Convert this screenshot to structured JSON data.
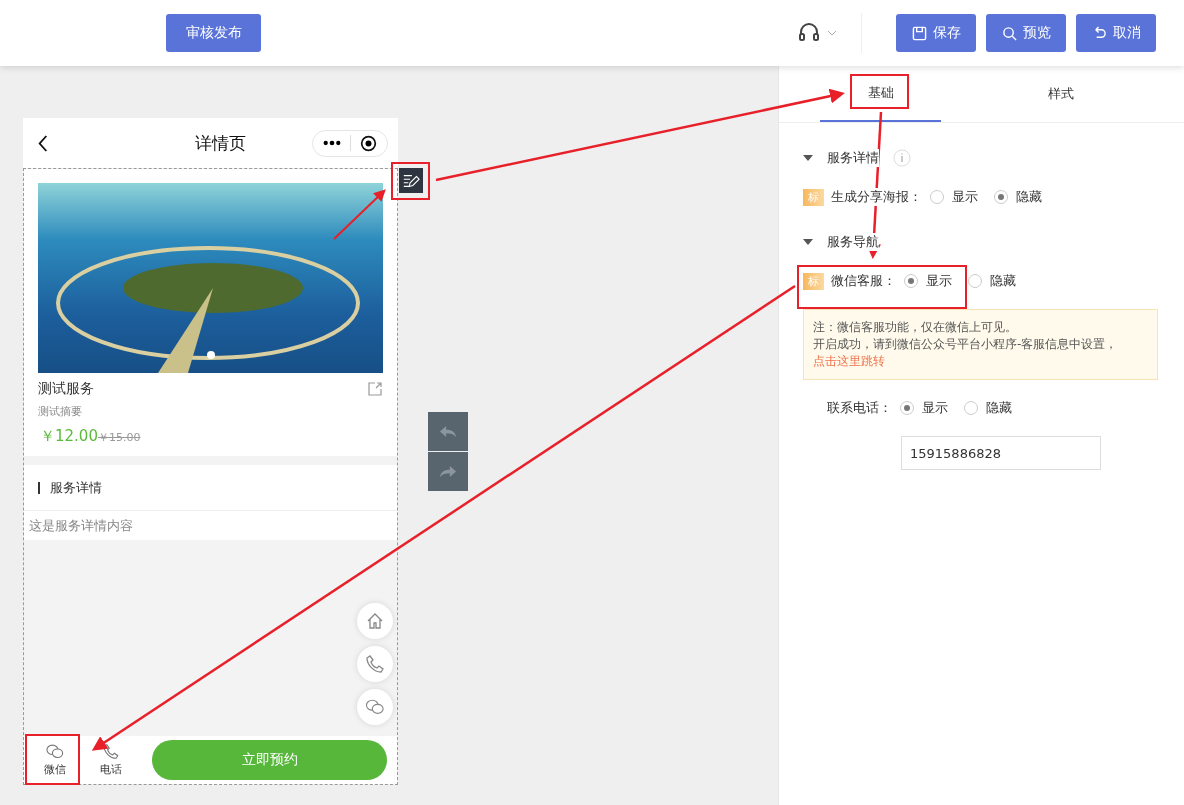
{
  "toolbar": {
    "publish_button": "审核发布",
    "buttons": [
      {
        "label": "保存",
        "kind": "save"
      },
      {
        "label": "预览",
        "kind": "preview"
      },
      {
        "label": "取消",
        "kind": "cancel"
      }
    ]
  },
  "phone": {
    "title": "详情页",
    "service_name": "测试服务",
    "summary": "测试摘要",
    "price": "￥12.00",
    "original_price": "￥15.00",
    "section_title": "服务详情",
    "section_content": "这是服务详情内容",
    "bottom_items": [
      {
        "label": "微信",
        "kind": "wechat"
      },
      {
        "label": "电话",
        "kind": "phone"
      }
    ],
    "book_button": "立即预约"
  },
  "tabs": [
    {
      "label": "基础",
      "selected": true
    },
    {
      "label": "样式",
      "selected": false
    }
  ],
  "sections": [
    {
      "title": "服务详情",
      "info": true,
      "rows": [
        {
          "kind": "radio",
          "badge": "标",
          "label": "生成分享海报：",
          "options": [
            {
              "label": "显示",
              "selected": false
            },
            {
              "label": "隐藏",
              "selected": true
            }
          ]
        }
      ]
    },
    {
      "title": "服务导航",
      "info": false,
      "rows": [
        {
          "kind": "radio",
          "badge": "标",
          "label": "微信客服：",
          "options": [
            {
              "label": "显示",
              "selected": true
            },
            {
              "label": "隐藏",
              "selected": false
            }
          ]
        },
        {
          "kind": "notice",
          "lines": [
            "注：微信客服功能，仅在微信上可见。",
            "开启成功，请到微信公众号平台小程序-客服信息中设置，"
          ],
          "link": "点击这里跳转"
        },
        {
          "kind": "radio",
          "label": "联系电话：",
          "options": [
            {
              "label": "显示",
              "selected": true
            },
            {
              "label": "隐藏",
              "selected": false
            }
          ]
        },
        {
          "kind": "input",
          "value": "15915886828"
        }
      ]
    }
  ]
}
